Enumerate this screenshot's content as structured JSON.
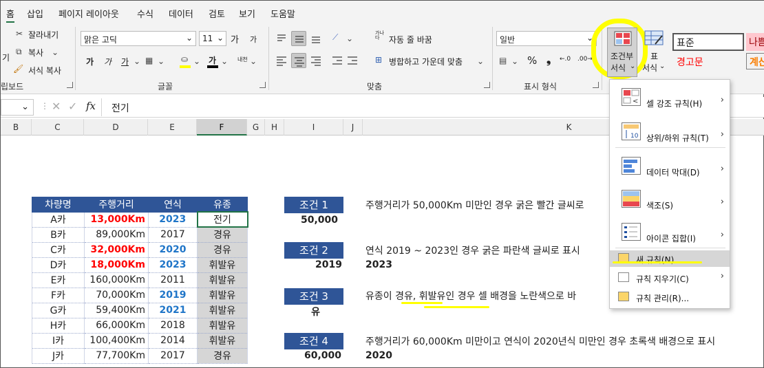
{
  "menu": [
    "홈",
    "삽입",
    "페이지 레이아웃",
    "수식",
    "데이터",
    "검토",
    "보기",
    "도움말"
  ],
  "clipboard": {
    "cut": "잘라내기",
    "copy": "복사",
    "format_painter": "서식 복사",
    "paste_fragment": "기",
    "group_label": "립보드"
  },
  "font": {
    "name": "맑은 고딕",
    "size": "11",
    "grow": "가",
    "shrink": "가",
    "bold": "가",
    "italic": "가",
    "underline": "가",
    "font_color_glyph": "가",
    "phonetic": "내천",
    "group_label": "글꼴"
  },
  "alignment": {
    "wrap_text": "자동 줄 바꿈",
    "merge_center": "병합하고 가운데 맞춤",
    "wrap_icon_text": "가나다",
    "group_label": "맞춤"
  },
  "number": {
    "format": "일반",
    "group_label": "표시 형식"
  },
  "styles": {
    "conditional_format_line1": "조건부",
    "conditional_format_line2": "서식",
    "table_format_line1": "표",
    "table_format_line2": "서식",
    "style_normal": "표준",
    "style_bad": "나쁨",
    "style_warning": "경고문",
    "style_calc": "계산"
  },
  "formula_bar": {
    "fx": "fx",
    "value": "전기"
  },
  "columns": [
    "B",
    "C",
    "D",
    "E",
    "F",
    "G",
    "H",
    "I",
    "J",
    "K"
  ],
  "table": {
    "headers": [
      "차량명",
      "주행거리",
      "연식",
      "유종"
    ],
    "rows": [
      [
        "A카",
        "13,000Km",
        "2023",
        "전기"
      ],
      [
        "B카",
        "89,000Km",
        "2017",
        "경유"
      ],
      [
        "C카",
        "32,000Km",
        "2020",
        "경유"
      ],
      [
        "D카",
        "18,000Km",
        "2023",
        "휘발유"
      ],
      [
        "E카",
        "160,000Km",
        "2011",
        "휘발유"
      ],
      [
        "F카",
        "70,000Km",
        "2019",
        "휘발유"
      ],
      [
        "G카",
        "59,400Km",
        "2021",
        "휘발유"
      ],
      [
        "H카",
        "66,000Km",
        "2018",
        "휘발유"
      ],
      [
        "I카",
        "100,400Km",
        "2014",
        "휘발유"
      ],
      [
        "J카",
        "77,700Km",
        "2017",
        "경유"
      ]
    ]
  },
  "conditions": [
    {
      "label": "조건 1",
      "value": "50,000",
      "desc": "주행거리가 50,000Km 미만인 경우 굵은 빨간 글씨로",
      "extra": ""
    },
    {
      "label": "조건 2",
      "value": "2019",
      "desc": "연식 2019 ~ 2023인 경우 굵은 파란색 글씨로 표시",
      "extra": "2023"
    },
    {
      "label": "조건 3",
      "value": "유",
      "desc": "유종이 경유, 휘발유인 경우 셀 배경을 노란색으로 바",
      "extra": ""
    },
    {
      "label": "조건 4",
      "value": "60,000",
      "desc": "주행거리가 60,000Km 미만이고 연식이 2020년식 미만인 경우 초록색 배경으로 표시",
      "extra": "2020"
    }
  ],
  "dropdown": {
    "items": [
      {
        "label": "셀 강조 규칙(H)",
        "has_arrow": true
      },
      {
        "label": "상위/하위 규칙(T)",
        "has_arrow": true
      },
      {
        "label": "데이터 막대(D)",
        "has_arrow": true
      },
      {
        "label": "색조(S)",
        "has_arrow": true
      },
      {
        "label": "아이콘 집합(I)",
        "has_arrow": true
      }
    ],
    "small_items": [
      {
        "label": "새 규칙(N)..."
      },
      {
        "label": "규칙 지우기(C)"
      },
      {
        "label": "규칙 관리(R)..."
      }
    ],
    "icon_texts": {
      "cell_rules": "<",
      "topbottom": "10"
    }
  },
  "colors": {
    "header_blue": "#2f5597",
    "red": "#ff0000",
    "blue": "#1f75c8",
    "highlight": "#ffff00",
    "excel_green": "#217346"
  }
}
